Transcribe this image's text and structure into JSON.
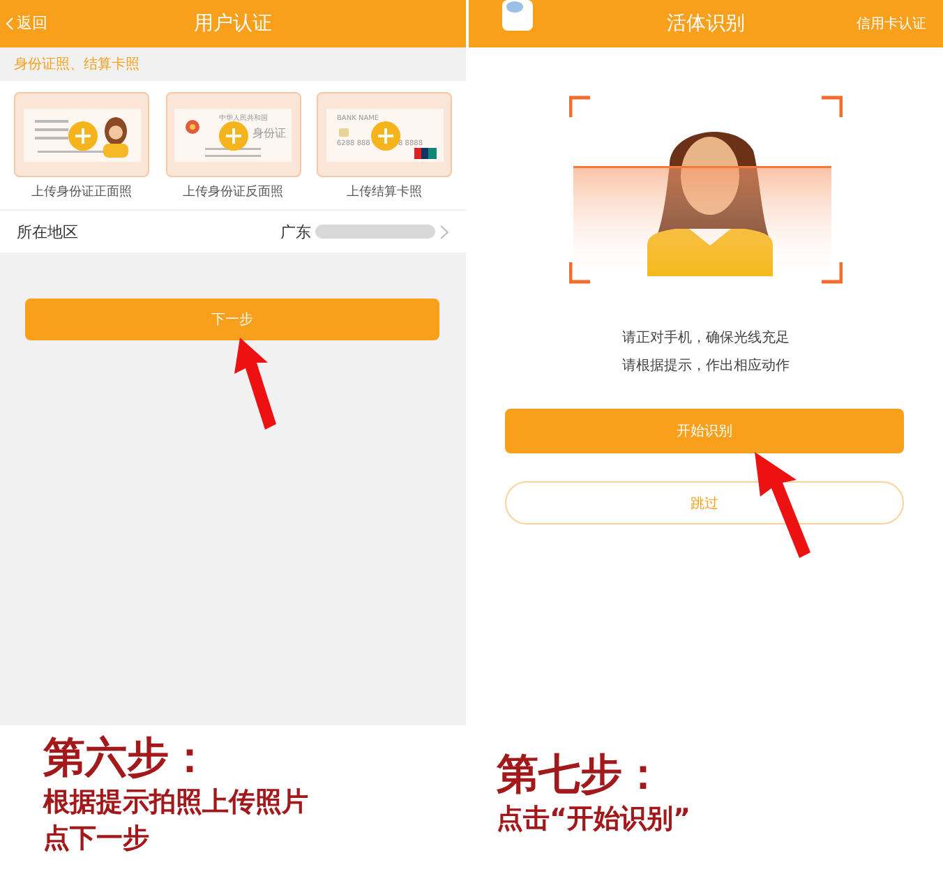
{
  "left_screen": {
    "back": "返回",
    "title": "用户认证",
    "section_label": "身份证照、结算卡照",
    "cards": [
      {
        "kind": "id_front",
        "caption": "上传身份证正面照"
      },
      {
        "kind": "id_back",
        "caption": "上传身份证反面照",
        "lines": [
          "中华人民共和国",
          "身份证"
        ]
      },
      {
        "kind": "bank",
        "caption": "上传结算卡照",
        "lines": [
          "BANK NAME",
          "6288 888",
          "8 8888"
        ]
      }
    ],
    "region": {
      "label": "所在地区",
      "value": "广东"
    },
    "next_button": "下一步"
  },
  "right_screen": {
    "title": "活体识别",
    "header_link": "信用卡认证",
    "instructions": [
      "请正对手机，确保光线充足",
      "请根据提示，作出相应动作"
    ],
    "start_button": "开始识别",
    "skip_button": "跳过"
  },
  "captions": [
    {
      "heading": "第六步：",
      "lines": [
        "根据提示拍照上传照片",
        "点下一步"
      ]
    },
    {
      "heading": "第七步：",
      "lines": [
        "点击“开始识别”"
      ]
    }
  ]
}
